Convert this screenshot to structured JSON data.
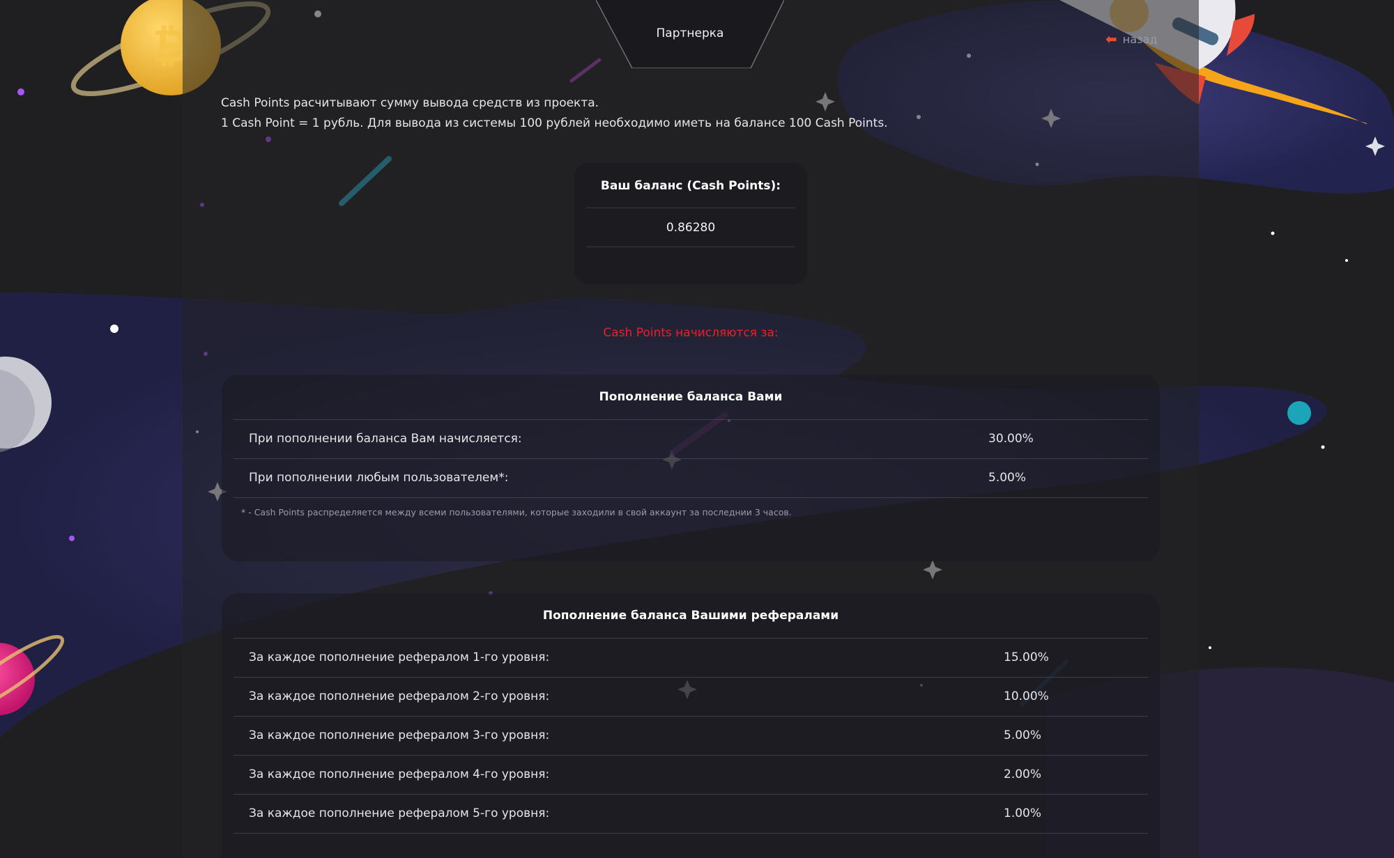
{
  "header": {
    "tab_label": "Партнерка",
    "back_label": "назад"
  },
  "intro": {
    "line1": "Cash Points расчитывают сумму вывода средств из проекта.",
    "line2": "1 Cash Point = 1 рубль. Для вывода из системы 100 рублей необходимо иметь на балансе 100 Cash Points."
  },
  "balance": {
    "title": "Ваш баланс (Cash Points):",
    "value": "0.86280"
  },
  "accrual_heading": "Cash Points начисляются за:",
  "own_topups": {
    "title": "Пополнение баланса Вами",
    "rows": [
      {
        "label": "При пополнении баланса Вам начисляется:",
        "value": "30.00%"
      },
      {
        "label": "При пополнении любым пользователем*:",
        "value": "5.00%"
      }
    ],
    "footnote": "* - Cash Points распределяется между всеми пользователями, которые заходили в свой аккаунт за последнии 3 часов."
  },
  "referral_topups": {
    "title": "Пополнение баланса Вашими рефералами",
    "rows": [
      {
        "label": "За каждое пополнение рефералом 1-го уровня:",
        "value": "15.00%"
      },
      {
        "label": "За каждое пополнение рефералом 2-го уровня:",
        "value": "10.00%"
      },
      {
        "label": "За каждое пополнение рефералом 3-го уровня:",
        "value": "5.00%"
      },
      {
        "label": "За каждое пополнение рефералом 4-го уровня:",
        "value": "2.00%"
      },
      {
        "label": "За каждое пополнение рефералом 5-го уровня:",
        "value": "1.00%"
      }
    ]
  },
  "colors": {
    "accent_red": "#e8202a",
    "back_arrow": "#e8502a",
    "background": "#1f1f22",
    "card": "#1c1c20"
  },
  "icons": {
    "back": "arrow-left-icon",
    "coin": "bitcoin-coin-icon",
    "rocket": "rocket-icon"
  }
}
